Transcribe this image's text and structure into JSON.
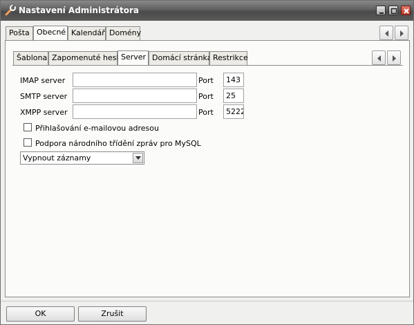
{
  "window": {
    "title": "Nastavení Administrátora",
    "icon": "wrench-icon"
  },
  "outer_tabs": [
    {
      "label": "Pošta"
    },
    {
      "label": "Obecné",
      "active": true
    },
    {
      "label": "Kalendář"
    },
    {
      "label": "Domény"
    }
  ],
  "inner_tabs": [
    {
      "label": "Šablona"
    },
    {
      "label": "Zapomenuté heslo"
    },
    {
      "label": "Server",
      "active": true
    },
    {
      "label": "Domácí stránka"
    },
    {
      "label": "Restrikce"
    }
  ],
  "servers": [
    {
      "label": "IMAP server",
      "value": "",
      "port_label": "Port",
      "port": "143"
    },
    {
      "label": "SMTP server",
      "value": "",
      "port_label": "Port",
      "port": "25"
    },
    {
      "label": "XMPP server",
      "value": "",
      "port_label": "Port",
      "port": "5222"
    }
  ],
  "checkboxes": [
    {
      "label": "Přihlašování e-mailovou adresou",
      "checked": false
    },
    {
      "label": "Podpora národního třídění zpráv pro MySQL",
      "checked": false
    }
  ],
  "logging_select": {
    "value": "Vypnout záznamy"
  },
  "buttons": {
    "ok": "OK",
    "cancel": "Zrušit"
  },
  "colors": {
    "titlebar": "#5e5e5e",
    "close": "#c0452f",
    "panel": "#fbfbf9",
    "background": "#f0f0ee"
  }
}
